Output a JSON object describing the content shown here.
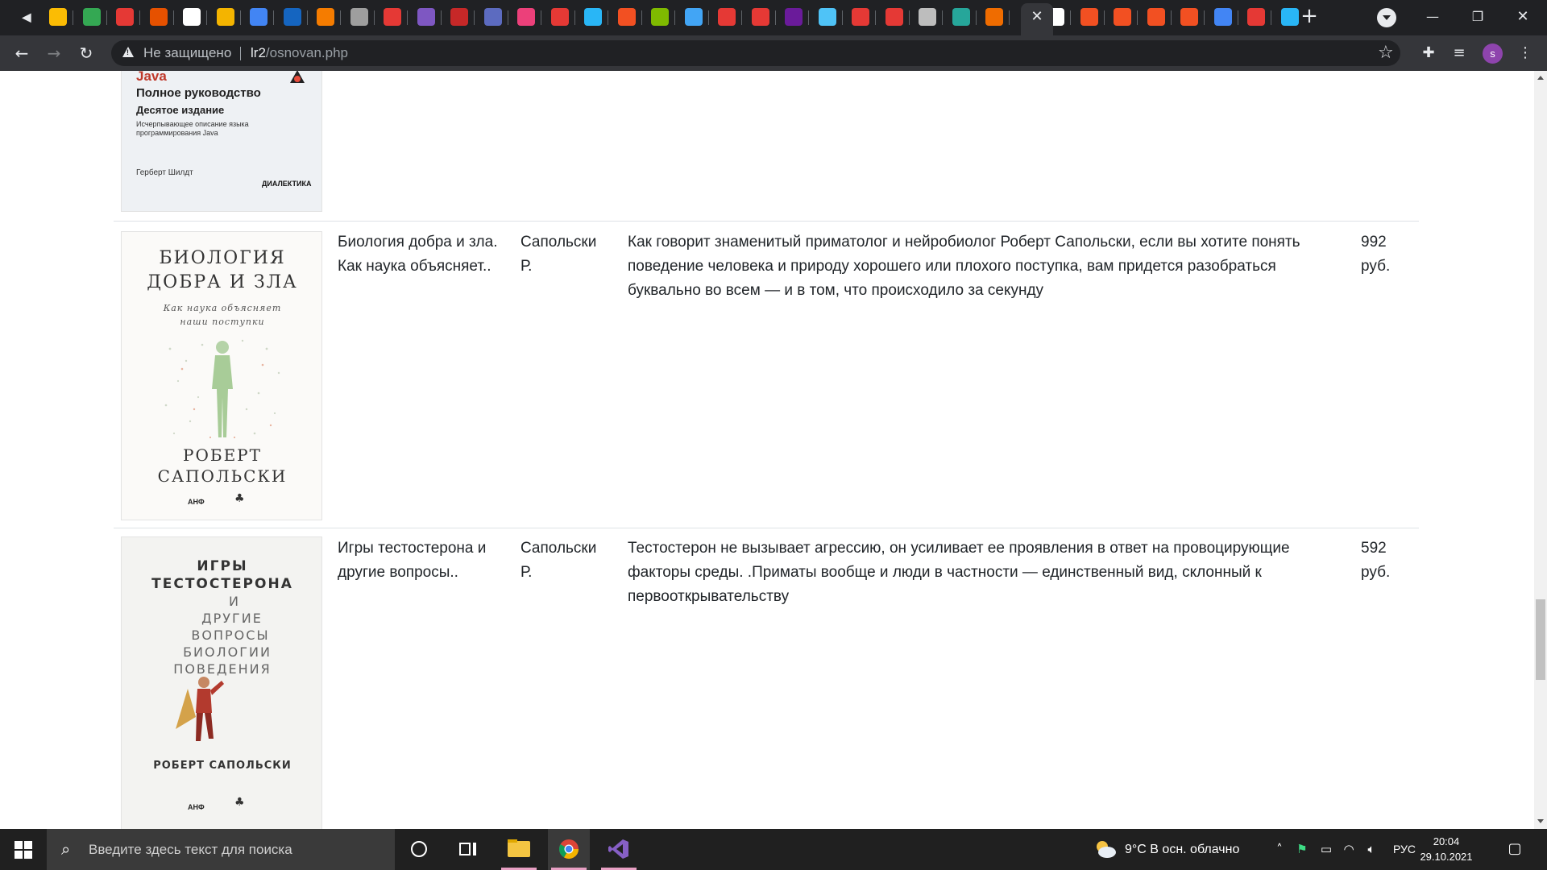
{
  "browser": {
    "tab_colors": [
      "#fbbc04",
      "#34a853",
      "#e53935",
      "#e65100",
      "#ffffff",
      "#f4b400",
      "#4285f4",
      "#1565c0",
      "#f57c00",
      "#9e9e9e",
      "#e53935",
      "#7e57c2",
      "#c62828",
      "#5c6bc0",
      "#ec407a",
      "#e53935",
      "#29b6f6",
      "#f25022",
      "#7fba00",
      "#42a5f5",
      "#e53935",
      "#e53935",
      "#6a1b9a",
      "#4fc3f7",
      "#e53935",
      "#e53935",
      "#bdbdbd",
      "#26a69a",
      "#ef6c00",
      "#ffffff",
      "#f25022",
      "#f25022",
      "#f25022",
      "#f25022",
      "#4285f4",
      "#e53935",
      "#29b6f6"
    ],
    "active_tab_close": "✕",
    "new_tab": "+",
    "omnibox": {
      "security_label": "Не защищено",
      "host": "lr2",
      "path": "/osnovan.php"
    },
    "profile_initial": "s",
    "icons": {
      "back": "arrow-left-icon",
      "forward": "arrow-right-icon",
      "reload": "reload-icon",
      "star": "star-icon",
      "extensions": "puzzle-icon",
      "media": "media-queue-icon",
      "menu": "kebab-menu-icon"
    }
  },
  "books": [
    {
      "cover": {
        "title_line1": "Java",
        "title_line2": "Полное руководство",
        "title_line3": "Десятое издание",
        "subtitle": "Исчерпывающее описание языка программирования Java",
        "author": "Герберт Шилдт",
        "publisher": "ДИАЛЕКТИКА"
      }
    },
    {
      "title": "Биология добра и зла. Как наука объясняет..",
      "author": "Сапольски Р.",
      "description": "Как говорит знаменитый приматолог и нейробиолог Роберт Сапольски, если вы хотите понять поведение человека и природу хорошего или плохого поступка, вам придется разобраться буквально во всем — и в том, что происходило за секунду",
      "price": "992 руб.",
      "cover": {
        "title_line1": "БИОЛОГИЯ",
        "title_line2": "ДОБРА И ЗЛА",
        "subtitle_line1": "Как наука объясняет",
        "subtitle_line2": "наши поступки",
        "author_line1": "РОБЕРТ",
        "author_line2": "САПОЛЬСКИ",
        "publisher": "АНФ"
      }
    },
    {
      "title": "Игры тестостерона и другие вопросы..",
      "author": "Сапольски Р.",
      "description": "Тестостерон не вызывает агрессию, он усиливает ее проявления в ответ на провоцирующие факторы среды. .Приматы вообще и люди в частности — единственный вид, склонный к первооткрывательству",
      "price": "592 руб.",
      "cover": {
        "title_line1": "ИГРЫ",
        "title_line2": "ТЕСТОСТЕРОНА",
        "lines": [
          "И",
          "ДРУГИЕ",
          "ВОПРОСЫ",
          "БИОЛОГИИ",
          "ПОВЕДЕНИЯ"
        ],
        "author": "РОБЕРТ САПОЛЬСКИ",
        "publisher": "АНФ"
      }
    }
  ],
  "taskbar": {
    "search_placeholder": "Введите здесь текст для поиска",
    "weather": "9°C  В осн. облачно",
    "language": "РУС",
    "time": "20:04",
    "date": "29.10.2021"
  }
}
